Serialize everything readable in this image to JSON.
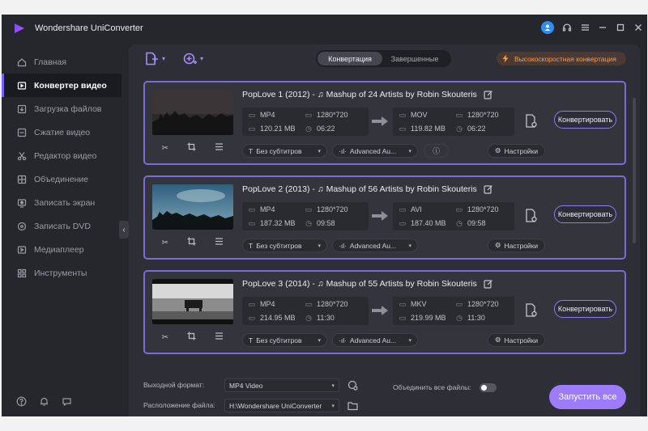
{
  "app": {
    "title": "Wondershare UniConverter",
    "window_controls": [
      "account-icon",
      "headset-icon",
      "menu-icon",
      "minimize-icon",
      "maximize-icon",
      "close-icon"
    ]
  },
  "sidebar": {
    "items": [
      {
        "label": "Главная",
        "icon": "home-icon",
        "active": false
      },
      {
        "label": "Конвертер видео",
        "icon": "video-converter-icon",
        "active": true
      },
      {
        "label": "Загрузка файлов",
        "icon": "download-icon",
        "active": false
      },
      {
        "label": "Сжатие видео",
        "icon": "compress-icon",
        "active": false
      },
      {
        "label": "Редактор видео",
        "icon": "scissors-icon",
        "active": false
      },
      {
        "label": "Объединение",
        "icon": "merge-icon",
        "active": false
      },
      {
        "label": "Записать экран",
        "icon": "screen-record-icon",
        "active": false
      },
      {
        "label": "Записать DVD",
        "icon": "dvd-icon",
        "active": false
      },
      {
        "label": "Медиаплеер",
        "icon": "play-icon",
        "active": false
      },
      {
        "label": "Инструменты",
        "icon": "toolbox-icon",
        "active": false
      }
    ],
    "bottom_icons": [
      "help-icon",
      "bell-icon",
      "feedback-icon"
    ]
  },
  "toolbar": {
    "tabs": [
      "Конвертация",
      "Завершенные"
    ],
    "active_tab": "Конвертация",
    "high_speed_label": "Высокоскоростная конвертация"
  },
  "files": [
    {
      "title": "PopLove 1 (2012) - ♫ Mashup of 24 Artists by Robin Skouteris",
      "src_format": "MP4",
      "src_resolution": "1280*720",
      "src_size": "120.21 MB",
      "src_duration": "06:22",
      "dst_format": "MOV",
      "dst_resolution": "1280*720",
      "dst_size": "119.82 MB",
      "dst_duration": "06:22",
      "subtitle": "Без субтитров",
      "audio": "Advanced Au...",
      "has_info_button": true,
      "settings_label": "Настройки",
      "convert_label": "Конвертировать"
    },
    {
      "title": "PopLove 2 (2013) - ♫ Mashup of 56 Artists by Robin Skouteris",
      "src_format": "MP4",
      "src_resolution": "1280*720",
      "src_size": "187.32 MB",
      "src_duration": "09:58",
      "dst_format": "AVI",
      "dst_resolution": "1280*720",
      "dst_size": "187.40 MB",
      "dst_duration": "09:58",
      "subtitle": "Без субтитров",
      "audio": "Advanced Au...",
      "has_info_button": false,
      "settings_label": "Настройки",
      "convert_label": "Конвертировать"
    },
    {
      "title": "PopLove 3 (2014) - ♫ Mashup of 55 Artists by Robin Skouteris",
      "src_format": "MP4",
      "src_resolution": "1280*720",
      "src_size": "214.95 MB",
      "src_duration": "11:30",
      "dst_format": "MKV",
      "dst_resolution": "1280*720",
      "dst_size": "219.99 MB",
      "dst_duration": "11:30",
      "subtitle": "Без субтитров",
      "audio": "Advanced Au...",
      "has_info_button": false,
      "settings_label": "Настройки",
      "convert_label": "Конвертировать"
    }
  ],
  "bottom": {
    "output_format_label": "Выходной формат:",
    "output_format_value": "MP4 Video",
    "merge_label": "Объединить все файлы:",
    "merge_enabled": false,
    "location_label": "Расположение файла:",
    "location_value": "H:\\Wondershare UniConverter",
    "start_all_label": "Запустить все"
  },
  "colors": {
    "accent": "#9d7bfa",
    "card_border": "#7a6bd6",
    "high_speed": "#ff9a4d",
    "background": "#26272d"
  }
}
